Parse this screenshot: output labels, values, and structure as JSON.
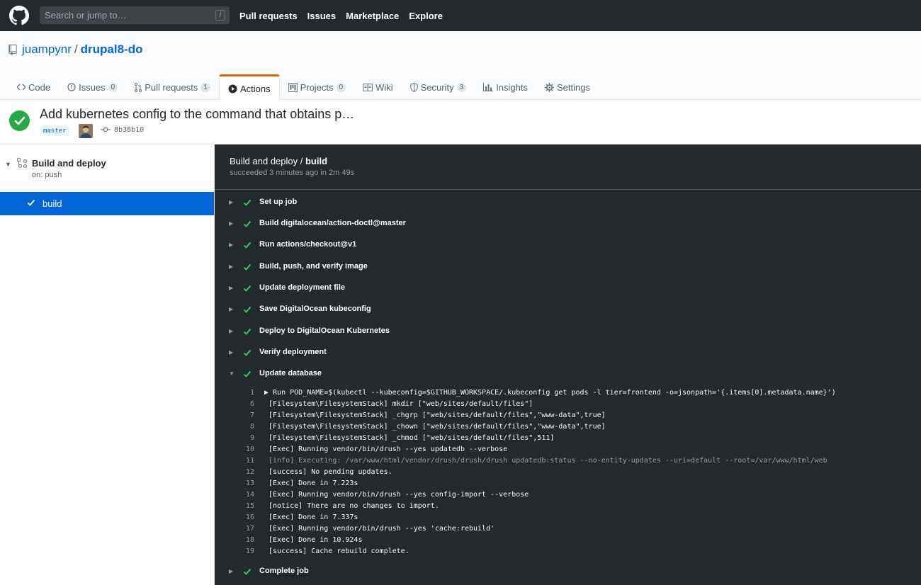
{
  "header": {
    "search_placeholder": "Search or jump to…",
    "search_shortcut": "/",
    "nav": [
      "Pull requests",
      "Issues",
      "Marketplace",
      "Explore"
    ]
  },
  "repo": {
    "owner": "juampynr",
    "separator": "/",
    "name": "drupal8-do"
  },
  "tabs": [
    {
      "label": "Code",
      "counter": null
    },
    {
      "label": "Issues",
      "counter": "0"
    },
    {
      "label": "Pull requests",
      "counter": "1"
    },
    {
      "label": "Actions",
      "counter": null
    },
    {
      "label": "Projects",
      "counter": "0"
    },
    {
      "label": "Wiki",
      "counter": null
    },
    {
      "label": "Security",
      "counter": "3"
    },
    {
      "label": "Insights",
      "counter": null
    },
    {
      "label": "Settings",
      "counter": null
    }
  ],
  "commit": {
    "title": "Add kubernetes config to the command that obtains p…",
    "branch": "master",
    "sha": "8b38b10"
  },
  "workflow": {
    "name": "Build and deploy",
    "trigger": "on: push",
    "job": "build"
  },
  "log": {
    "title_prefix": "Build and deploy / ",
    "title_job": "build",
    "status": "succeeded 3 minutes ago in 2m 49s",
    "steps": [
      "Set up job",
      "Build digitalocean/action-doctl@master",
      "Run actions/checkout@v1",
      "Build, push, and verify image",
      "Update deployment file",
      "Save DigitalOcean kubeconfig",
      "Deploy to DigitalOcean Kubernetes",
      "Verify deployment",
      "Update database"
    ],
    "lines": [
      {
        "n": "1",
        "t": "▶ Run POD_NAME=$(kubectl --kubeconfig=$GITHUB_WORKSPACE/.kubeconfig get pods -l tier=frontend -o=jsonpath='{.items[0].metadata.name}')"
      },
      {
        "n": "6",
        "t": " [Filesystem\\FilesystemStack] mkdir [\"web/sites/default/files\"]"
      },
      {
        "n": "7",
        "t": " [Filesystem\\FilesystemStack] _chgrp [\"web/sites/default/files\",\"www-data\",true]"
      },
      {
        "n": "8",
        "t": " [Filesystem\\FilesystemStack] _chown [\"web/sites/default/files\",\"www-data\",true]"
      },
      {
        "n": "9",
        "t": " [Filesystem\\FilesystemStack] _chmod [\"web/sites/default/files\",511]"
      },
      {
        "n": "10",
        "t": " [Exec] Running vendor/bin/drush --yes updatedb --verbose"
      },
      {
        "n": "11",
        "t": " [info] Executing: /var/www/html/vendor/drush/drush/drush updatedb:status --no-entity-updates --uri=default --root=/var/www/html/web"
      },
      {
        "n": "12",
        "t": " [success] No pending updates."
      },
      {
        "n": "13",
        "t": " [Exec] Done in 7.223s"
      },
      {
        "n": "14",
        "t": " [Exec] Running vendor/bin/drush --yes config-import --verbose"
      },
      {
        "n": "15",
        "t": " [notice] There are no changes to import."
      },
      {
        "n": "16",
        "t": " [Exec] Done in 7.337s"
      },
      {
        "n": "17",
        "t": " [Exec] Running vendor/bin/drush --yes 'cache:rebuild'"
      },
      {
        "n": "18",
        "t": " [Exec] Done in 10.924s"
      },
      {
        "n": "19",
        "t": " [success] Cache rebuild complete."
      }
    ],
    "final_step": "Complete job"
  }
}
